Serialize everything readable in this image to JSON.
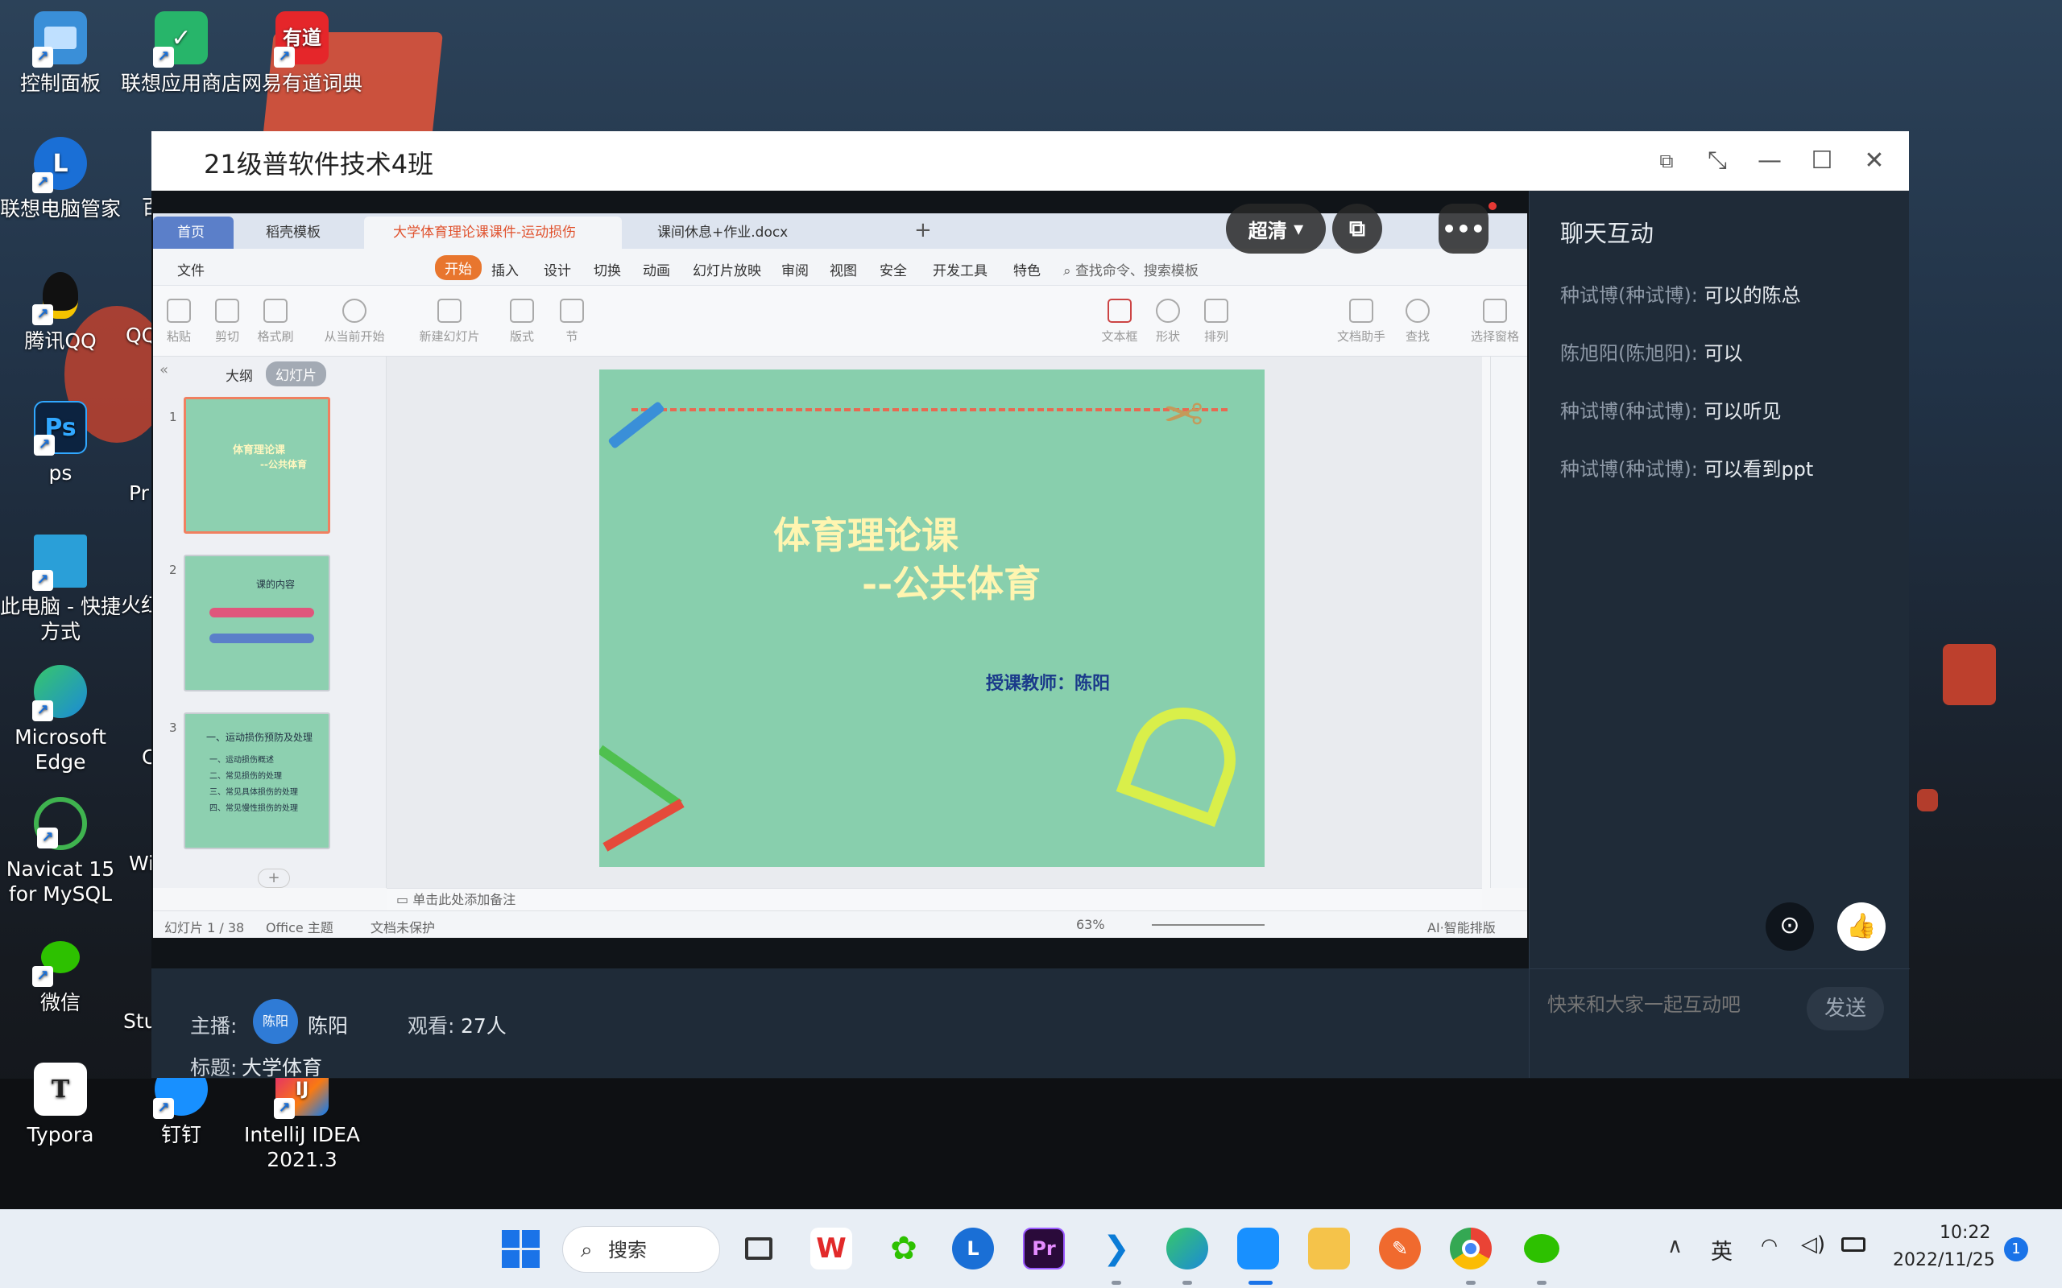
{
  "desktop": {
    "icons": [
      {
        "label": "控制面板",
        "icon": "control-panel-icon",
        "color": "#3a8fd8"
      },
      {
        "label": "联想应用商店",
        "icon": "lenovo-store-icon",
        "color": "#27b56a"
      },
      {
        "label": "网易有道词典",
        "icon": "youdao-icon",
        "color": "#e5262a",
        "glyph": "有道"
      },
      {
        "label": "联想电脑管家",
        "icon": "lenovo-pc-manager-icon",
        "color": "#1a6fd6"
      },
      {
        "label": "腾讯QQ",
        "icon": "qq-penguin-icon",
        "color": "#111111"
      },
      {
        "label": "ps",
        "icon": "photoshop-icon",
        "color": "#0c2340",
        "glyph": "Ps"
      },
      {
        "label": "此电脑 - 快捷方式",
        "line1": "此电脑 - 快捷",
        "line2": "方式",
        "icon": "this-pc-icon",
        "color": "#2a9fd8"
      },
      {
        "label": "Microsoft Edge",
        "line1": "Microsoft",
        "line2": "Edge",
        "icon": "edge-icon",
        "color": "#1b8ad8"
      },
      {
        "label": "Navicat 15 for MySQL",
        "line1": "Navicat 15",
        "line2": "for MySQL",
        "icon": "navicat-icon",
        "color": "#3fb34f"
      },
      {
        "label": "微信",
        "icon": "wechat-icon",
        "color": "#2dc100"
      },
      {
        "label": "Typora",
        "icon": "typora-icon",
        "color": "#ffffff",
        "glyph": "T"
      },
      {
        "label": "钉钉",
        "icon": "dingtalk-icon",
        "color": "#1890ff"
      },
      {
        "label": "IntelliJ IDEA 2021.3",
        "line1": "IntelliJ IDEA",
        "line2": "2021.3",
        "icon": "intellij-icon",
        "color": "#e0207a",
        "glyph": "IJ"
      }
    ],
    "peeks": [
      "百",
      "QQ",
      "Pr",
      "火红",
      "C",
      "Wi",
      "Stu"
    ]
  },
  "window": {
    "title": "21级普软件技术4班",
    "buttons": [
      "popout-icon",
      "shrink-icon",
      "minimize-icon",
      "maximize-icon",
      "close-icon"
    ]
  },
  "stream": {
    "quality": "超清",
    "wps": {
      "tabs": [
        "首页",
        "稻壳模板",
        "大学体育理论课课件-运动损伤",
        "课间休息+作业.docx"
      ],
      "menu": [
        "文件",
        "开始",
        "插入",
        "设计",
        "切换",
        "动画",
        "幻灯片放映",
        "审阅",
        "视图",
        "安全",
        "开发工具",
        "特色"
      ],
      "search": "查找命令、搜索模板",
      "ribbon": [
        "粘贴",
        "剪切",
        "格式刷",
        "从当前开始",
        "新建幻灯片",
        "版式",
        "节",
        "文本框",
        "形状",
        "排列",
        "文档助手",
        "查找",
        "选择窗格"
      ],
      "pane_tabs": [
        "大纲",
        "幻灯片"
      ],
      "thumbs": [
        {
          "num": "1",
          "title": "体育理论课",
          "sub": "--公共体育"
        },
        {
          "num": "2",
          "title": "课的内容"
        },
        {
          "num": "3",
          "title": "一、运动损伤预防及处理",
          "bullets": [
            "一、运动损伤概述",
            "二、常见损伤的处理",
            "三、常见具体损伤的处理",
            "四、常见慢性损伤的处理"
          ]
        }
      ],
      "slide": {
        "title": "体育理论课",
        "subtitle": "--公共体育",
        "teacher": "授课教师：陈阳"
      },
      "notes_placeholder": "单击此处添加备注",
      "status": {
        "slide_count": "幻灯片 1 / 38",
        "theme": "Office 主题",
        "protect": "文档未保护",
        "zoom": "63%",
        "ai": "AI·智能排版"
      }
    }
  },
  "info": {
    "host_label": "主播:",
    "host_avatar": "陈阳",
    "host_name": "陈阳",
    "viewers_label": "观看:",
    "viewers": "27人",
    "title_label": "标题:",
    "title": "大学体育"
  },
  "chat": {
    "header": "聊天互动",
    "messages": [
      {
        "user": "种试博(种试博):",
        "text": "可以的陈总"
      },
      {
        "user": "陈旭阳(陈旭阳):",
        "text": "可以"
      },
      {
        "user": "种试博(种试博):",
        "text": "可以听见"
      },
      {
        "user": "种试博(种试博):",
        "text": "可以看到ppt"
      }
    ],
    "input_placeholder": "快来和大家一起互动吧",
    "send_label": "发送"
  },
  "taskbar": {
    "search_label": "搜索",
    "ime": "英",
    "time": "10:22",
    "date": "2022/11/25",
    "notification_count": "1",
    "apps": [
      "start-icon",
      "search-icon",
      "task-view-icon",
      "wps-icon",
      "wechat-mini-icon",
      "lenovo-icon",
      "premiere-icon",
      "vscode-icon",
      "edge-icon",
      "dingtalk-icon",
      "file-explorer-icon",
      "pen-icon",
      "chrome-icon",
      "wechat-icon"
    ]
  }
}
